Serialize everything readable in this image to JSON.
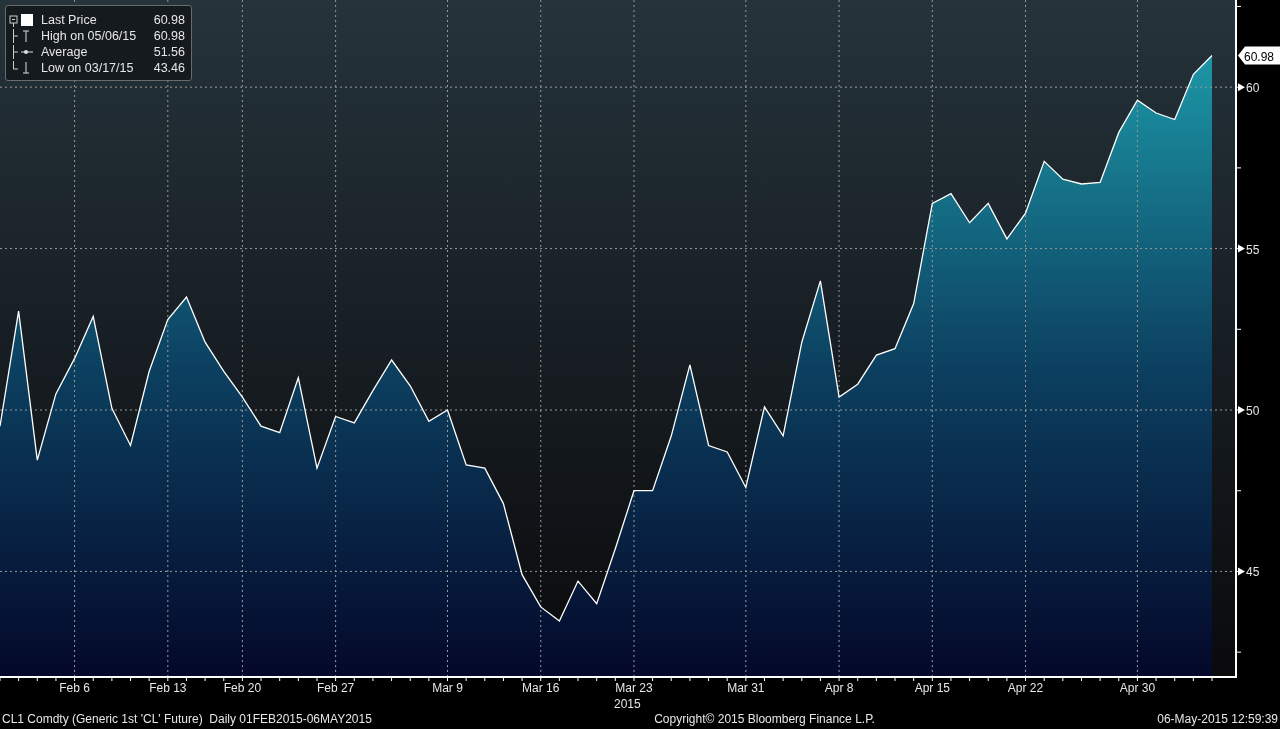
{
  "legend": [
    {
      "kind": "last",
      "label": "Last Price",
      "value": "60.98"
    },
    {
      "kind": "high",
      "label": "High on 05/06/15",
      "value": "60.98"
    },
    {
      "kind": "average",
      "label": "Average",
      "value": "51.56"
    },
    {
      "kind": "low",
      "label": "Low on 03/17/15",
      "value": "43.46"
    }
  ],
  "last_price_tag": "60.98",
  "chart_data": {
    "type": "area",
    "categories": [
      null,
      null,
      null,
      null,
      "Feb 6",
      null,
      null,
      null,
      null,
      "Feb 13",
      null,
      null,
      null,
      "Feb 20",
      null,
      null,
      null,
      null,
      "Feb 27",
      null,
      null,
      null,
      null,
      null,
      "Mar 9",
      null,
      null,
      null,
      null,
      "Mar 16",
      null,
      null,
      null,
      null,
      "Mar 23",
      null,
      null,
      null,
      null,
      null,
      "Mar 31",
      null,
      null,
      null,
      null,
      "Apr 8",
      null,
      null,
      null,
      null,
      "Apr 15",
      null,
      null,
      null,
      null,
      "Apr 22",
      null,
      null,
      null,
      null,
      null,
      "Apr 30",
      null,
      null,
      null,
      null
    ],
    "series": [
      {
        "color": "#ffffff",
        "values": [
          49.5,
          53.06,
          48.45,
          50.5,
          51.6,
          52.9,
          50.05,
          48.9,
          51.2,
          52.8,
          53.5,
          52.1,
          51.2,
          50.4,
          49.5,
          49.3,
          51.0,
          48.2,
          49.8,
          49.6,
          50.6,
          51.55,
          50.75,
          49.65,
          50.0,
          48.3,
          48.2,
          47.1,
          44.9,
          43.9,
          43.46,
          44.7,
          44.0,
          45.7,
          47.5,
          47.5,
          49.2,
          51.4,
          48.9,
          48.7,
          47.6,
          50.1,
          49.2,
          52.1,
          54.0,
          50.4,
          50.8,
          51.7,
          51.9,
          53.3,
          56.4,
          56.7,
          55.8,
          56.4,
          55.3,
          56.1,
          57.7,
          57.15,
          57.0,
          57.05,
          58.6,
          59.6,
          59.2,
          59.0,
          60.4,
          60.98
        ]
      }
    ],
    "ylim": [
      41.73,
      62.7
    ],
    "yticks": [
      45,
      50,
      55,
      60
    ],
    "grid": true,
    "annotations": [
      "2015"
    ]
  },
  "footer": {
    "security": "CL1 Comdty (Generic 1st 'CL' Future)  Daily 01FEB2015-06MAY2015",
    "copyright": "Copyright© 2015 Bloomberg Finance L.P.",
    "timestamp": "06-May-2015 12:59:39"
  }
}
